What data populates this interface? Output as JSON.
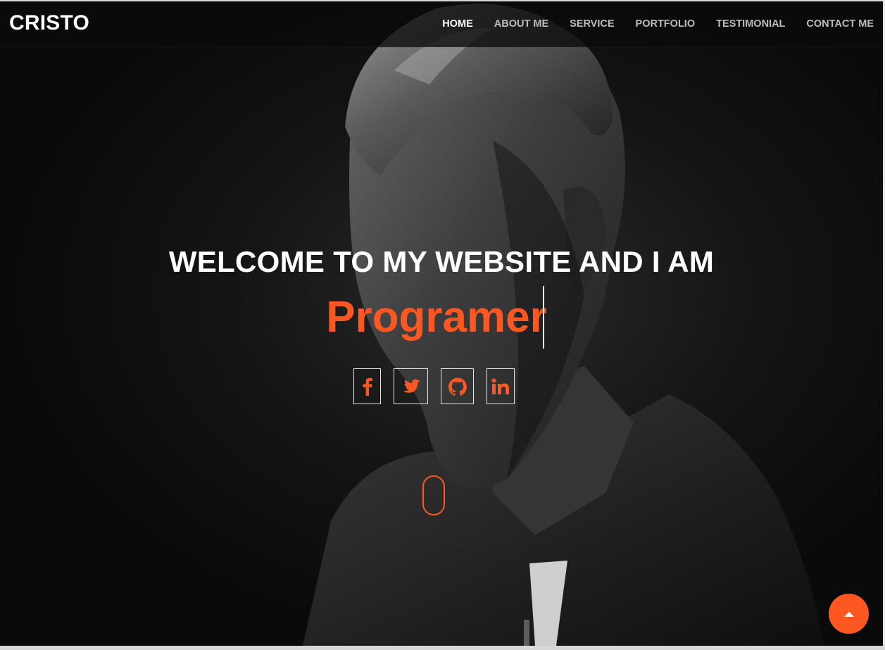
{
  "brand": "CRISTO",
  "nav": [
    {
      "label": "HOME",
      "active": true
    },
    {
      "label": "ABOUT ME",
      "active": false
    },
    {
      "label": "SERVICE",
      "active": false
    },
    {
      "label": "PORTFOLIO",
      "active": false
    },
    {
      "label": "TESTIMONIAL",
      "active": false
    },
    {
      "label": "CONTACT ME",
      "active": false
    }
  ],
  "hero": {
    "heading": "WELCOME TO MY WEBSITE AND I AM",
    "typed_role": "Programer"
  },
  "social_icons": [
    "facebook-icon",
    "twitter-icon",
    "github-icon",
    "linkedin-icon"
  ],
  "icons": {
    "scroll": "scroll-mouse-icon",
    "back_to_top": "caret-up-icon"
  },
  "colors": {
    "accent": "#ff5722",
    "background": "#0b0b0b",
    "text": "#ffffff",
    "nav_text": "#bdbdbd"
  }
}
